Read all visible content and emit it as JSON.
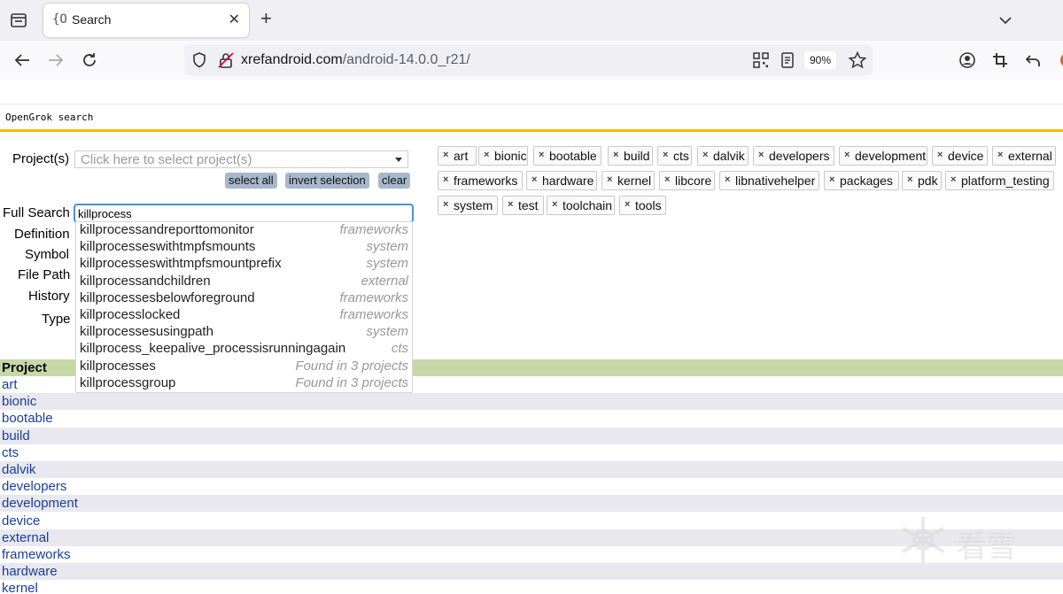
{
  "browser": {
    "tab": {
      "title": "Search",
      "favicon": "{O"
    },
    "url": {
      "domain": "xrefandroid.com",
      "path": "/android-14.0.0_r21/"
    },
    "zoom": "90%"
  },
  "page": {
    "header_title": "OpenGrok search",
    "labels": {
      "projects": "Project(s)",
      "full_search": "Full Search",
      "definition": "Definition",
      "symbol": "Symbol",
      "file_path": "File Path",
      "history": "History",
      "type": "Type"
    },
    "project_select_placeholder": "Click here to select project(s)",
    "buttons": {
      "select_all": "select all",
      "invert_selection": "invert selection",
      "clear": "clear"
    },
    "search_value": "killprocess",
    "suggestions": [
      {
        "term": "killprocessandreporttomonitor",
        "project": "frameworks"
      },
      {
        "term": "killprocesseswithtmpfsmounts",
        "project": "system"
      },
      {
        "term": "killprocesseswithtmpfsmountprefix",
        "project": "system"
      },
      {
        "term": "killprocessandchildren",
        "project": "external"
      },
      {
        "term": "killprocessesbelowforeground",
        "project": "frameworks"
      },
      {
        "term": "killprocesslocked",
        "project": "frameworks"
      },
      {
        "term": "killprocessesusingpath",
        "project": "system"
      },
      {
        "term": "killprocess_keepalive_processisrunningagain",
        "project": "cts"
      },
      {
        "term": "killprocesses",
        "project": "Found in 3 projects"
      },
      {
        "term": "killprocessgroup",
        "project": "Found in 3 projects"
      }
    ],
    "selected_projects": [
      "art",
      "bionic",
      "bootable",
      "build",
      "cts",
      "dalvik",
      "developers",
      "development",
      "device",
      "external",
      "frameworks",
      "hardware",
      "kernel",
      "libcore",
      "libnativehelper",
      "packages",
      "pdk",
      "platform_testing",
      "system",
      "test",
      "toolchain",
      "tools"
    ],
    "table_header": "Project",
    "project_rows": [
      "art",
      "bionic",
      "bootable",
      "build",
      "cts",
      "dalvik",
      "developers",
      "development",
      "device",
      "external",
      "frameworks",
      "hardware",
      "kernel"
    ],
    "watermark_text": "看雪"
  }
}
